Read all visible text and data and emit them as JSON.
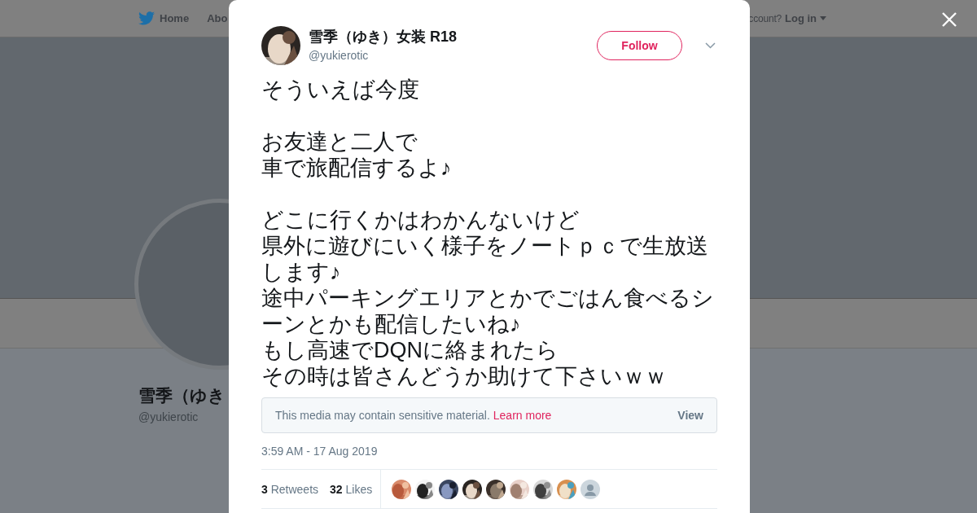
{
  "nav": {
    "items": [
      {
        "label": "Home"
      },
      {
        "label": "Abo"
      }
    ],
    "login_prompt": "ccount?",
    "login": "Log in"
  },
  "profile": {
    "name": "雪季（ゆき",
    "handle": "@yukierotic"
  },
  "tweet": {
    "author": {
      "name": "雪季（ゆき）女装 R18",
      "handle": "@yukierotic"
    },
    "follow": "Follow",
    "paragraphs": [
      [
        "そういえば今度"
      ],
      [
        "お友達と二人で",
        "車で旅配信するよ♪"
      ],
      [
        "どこに行くかはわかんないけど",
        "県外に遊びにいく様子をノートｐｃで生放送します♪",
        "途中パーキングエリアとかでごはん食べるシーンとかも配信したいね♪",
        "もし高速でDQNに絡まれたら",
        "その時は皆さんどうか助けて下さいｗｗ"
      ]
    ],
    "sensitive": {
      "message": "This media may contain sensitive material.",
      "link": "Learn more",
      "action": "View"
    },
    "timestamp": "3:59 AM - 17 Aug 2019",
    "stats": [
      {
        "count": "3",
        "label": "Retweets"
      },
      {
        "count": "32",
        "label": "Likes"
      }
    ],
    "likers": [
      {
        "kind": "picture"
      },
      {
        "kind": "picture"
      },
      {
        "kind": "picture"
      },
      {
        "kind": "picture"
      },
      {
        "kind": "picture"
      },
      {
        "kind": "picture"
      },
      {
        "kind": "picture"
      },
      {
        "kind": "picture"
      },
      {
        "kind": "default"
      }
    ]
  }
}
